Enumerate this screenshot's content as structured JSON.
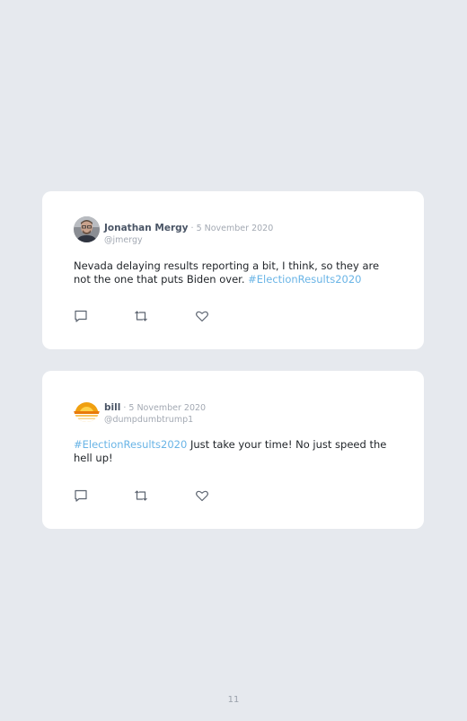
{
  "tweets": [
    {
      "author_name": "Jonathan Mergy",
      "date": "5 November 2020",
      "handle": "@jmergy",
      "text_before": "Nevada delaying results reporting a bit, I think, so they are not the one that puts Biden over. ",
      "hashtag": "#ElectionResults2020",
      "text_after": "",
      "avatar_icon": "profile-photo-man",
      "actions": [
        "comment-icon",
        "retweet-icon",
        "heart-icon"
      ]
    },
    {
      "author_name": "bill",
      "date": "5 November 2020",
      "handle": "@dumpdumbtrump1",
      "text_before": "",
      "hashtag": "#ElectionResults2020",
      "text_after": " Just take your time! No just speed the hell up!",
      "avatar_icon": "profile-photo-sunset",
      "actions": [
        "comment-icon",
        "retweet-icon",
        "heart-icon"
      ]
    }
  ],
  "separator": " · ",
  "page_number": "11",
  "colors": {
    "background": "#e6e9ee",
    "card": "#ffffff",
    "hashtag": "#69b4e6",
    "name": "#4a5566",
    "muted": "#a3a9b3"
  }
}
